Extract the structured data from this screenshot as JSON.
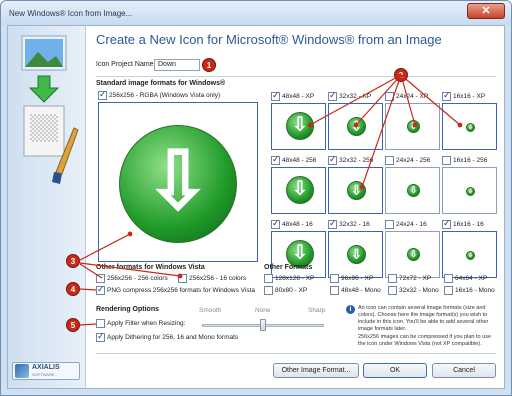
{
  "window": {
    "title": "New Windows® Icon from Image...",
    "close_glyph": "✕"
  },
  "heading": "Create a New Icon for Microsoft® Windows® from an Image",
  "project": {
    "label": "Icon Project Name:",
    "value": "Down"
  },
  "standard_formats": {
    "label": "Standard image formats for Windows®",
    "large": {
      "label": "256x256 - RGBA (Windows Vista only)",
      "checked": true
    }
  },
  "grid": {
    "rows": [
      [
        {
          "label": "48x48 - XP",
          "checked": true
        },
        {
          "label": "32x32 - XP",
          "checked": true
        },
        {
          "label": "24x24 - XP",
          "checked": false
        },
        {
          "label": "16x16 - XP",
          "checked": true
        }
      ],
      [
        {
          "label": "48x48 - 256",
          "checked": true
        },
        {
          "label": "32x32 - 256",
          "checked": true
        },
        {
          "label": "24x24 - 256",
          "checked": false
        },
        {
          "label": "16x16 - 256",
          "checked": false
        }
      ],
      [
        {
          "label": "48x48 - 16",
          "checked": true
        },
        {
          "label": "32x32 - 16",
          "checked": true
        },
        {
          "label": "24x24 - 16",
          "checked": false
        },
        {
          "label": "16x16 - 16",
          "checked": true
        }
      ]
    ]
  },
  "vista": {
    "label": "Other formats for Windows Vista",
    "opt1": "256x256 - 256 colors",
    "opt2": "256x256 - 16 colors",
    "png": "PNG compress 256x256 formats for Windows Vista"
  },
  "other": {
    "label": "Other Formats",
    "items": [
      "128x128 - XP",
      "96x96 - XP",
      "72x72 - XP",
      "64x64 - XP",
      "80x80 - XP",
      "48x48 - Mono",
      "32x32 - Mono",
      "16x16 - Mono"
    ]
  },
  "rendering": {
    "label": "Rendering Options",
    "smooth": "Smooth",
    "none": "None",
    "sharp": "Sharp",
    "filter": "Apply Filter when Resizing:",
    "dither": "Apply Dithering for 256, 16 and Mono formats",
    "slider_level": 0.5
  },
  "info": {
    "p1": "An icon can contain several image formats (size and colors). Choose here the image format(s) you wish to include in this icon. You'll be able to add several other image formats later.",
    "p2": "256x256 images can be compressed if you plan to use the icon under Windows Vista (not XP compatible)."
  },
  "buttons": {
    "other": "Other Image Format...",
    "ok": "OK",
    "cancel": "Cancel"
  },
  "logo": {
    "name": "AXIALIS",
    "sub": "SOFTWARE"
  },
  "badges": [
    "1",
    "2",
    "3",
    "4",
    "5"
  ],
  "colors": {
    "heading": "#2a5a9a",
    "badge": "#c82a16",
    "arrow_green": "#1f9a28"
  }
}
